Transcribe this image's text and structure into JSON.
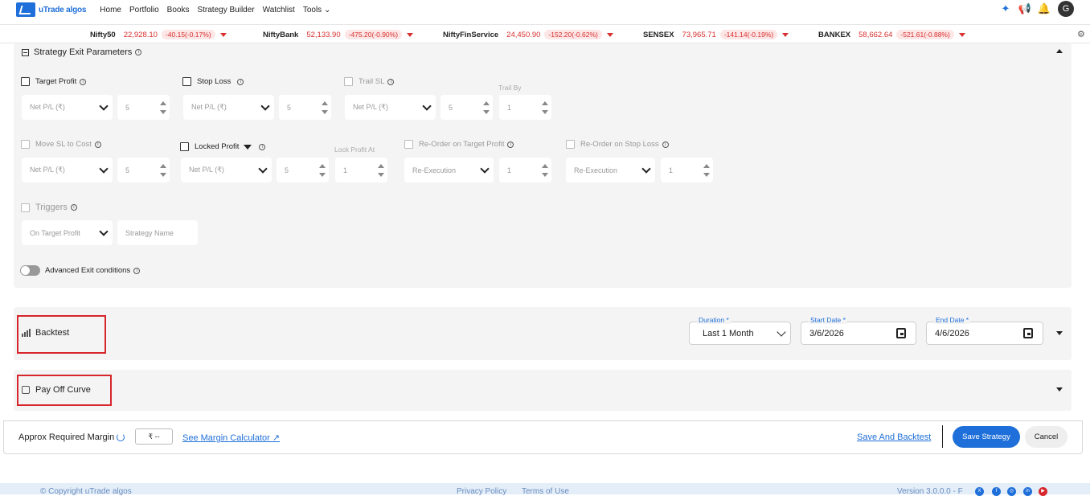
{
  "nav": {
    "logo_text": "uTrade algos",
    "links": [
      "Home",
      "Portfolio",
      "Books",
      "Strategy Builder",
      "Watchlist",
      "Tools"
    ],
    "avatar": "G"
  },
  "ticker": [
    {
      "name": "Nifty50",
      "price": "22,928.10",
      "change": "-40.15(-0.17%)"
    },
    {
      "name": "NiftyBank",
      "price": "52,133.90",
      "change": "-475.20(-0.90%)"
    },
    {
      "name": "NiftyFinService",
      "price": "24,450.90",
      "change": "-152.20(-0.62%)"
    },
    {
      "name": "SENSEX",
      "price": "73,965.71",
      "change": "-141.14(-0.19%)"
    },
    {
      "name": "BANKEX",
      "price": "58,662.64",
      "change": "-521.61(-0.88%)"
    }
  ],
  "exit": {
    "title": "Strategy Exit Parameters",
    "target_profit": "Target Profit",
    "stop_loss": "Stop Loss",
    "trail_sl": "Trail SL",
    "trail_by": "Trail By",
    "net_pl": "Net P/L (₹)",
    "five": "5",
    "one": "1",
    "move_sl": "Move SL to Cost",
    "locked_profit": "Locked Profit",
    "lock_profit_at": "Lock Profit At",
    "reorder_tp": "Re-Order on Target Profit",
    "reorder_sl": "Re-Order on Stop Loss",
    "re_execution": "Re-Execution",
    "triggers": "Triggers",
    "on_target_profit": "On Target Profit",
    "strategy_name": "Strategy Name",
    "advanced": "Advanced Exit conditions"
  },
  "backtest": {
    "title": "Backtest",
    "duration_label": "Duration *",
    "duration_value": "Last 1 Month",
    "start_label": "Start Date *",
    "start_value": "3/6/2026",
    "end_label": "End Date *",
    "end_value": "4/6/2026"
  },
  "payoff": {
    "title": "Pay Off Curve"
  },
  "footer": {
    "margin_label": "Approx Required Margin",
    "margin_value": "₹ --",
    "margin_calc": "See Margin Calculator ↗",
    "save_backtest": "Save And Backtest",
    "save_strategy": "Save Strategy",
    "cancel": "Cancel"
  },
  "bottom": {
    "copyright": "© Copyright uTrade algos",
    "privacy": "Privacy Policy",
    "terms": "Terms of Use",
    "version": "Version 3.0.0.0 - F"
  },
  "colors": {
    "accent": "#1e6fd9",
    "negative": "#d93030",
    "highlight": "#d6262b"
  }
}
